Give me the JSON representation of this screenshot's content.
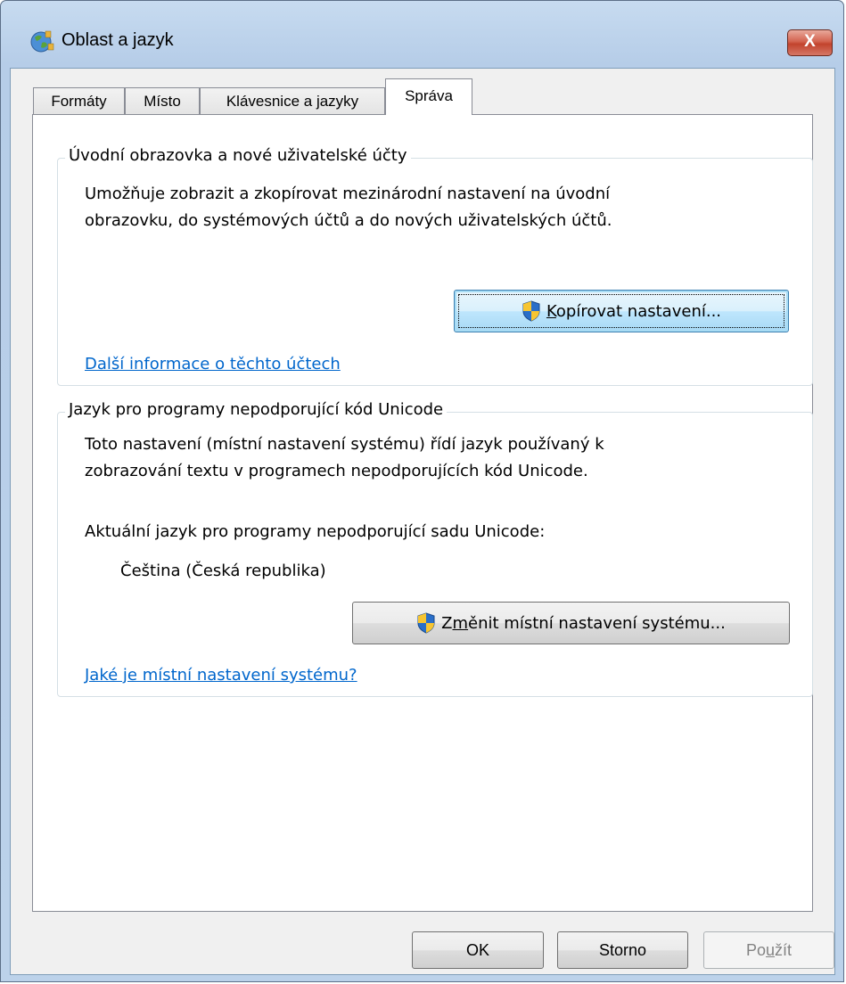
{
  "window": {
    "title": "Oblast a jazyk",
    "close_glyph": "X",
    "icon": "globe-icon"
  },
  "tabs": [
    {
      "label": "Formáty",
      "active": false
    },
    {
      "label": "Místo",
      "active": false
    },
    {
      "label": "Klávesnice a jazyky",
      "active": false
    },
    {
      "label": "Správa",
      "active": true
    }
  ],
  "welcome_group": {
    "title": "Úvodní obrazovka a nové uživatelské účty",
    "description_line1": "Umožňuje zobrazit a zkopírovat mezinárodní nastavení na úvodní",
    "description_line2": "obrazovku, do systémových účtů a do nových uživatelských účtů.",
    "copy_button_accel": "K",
    "copy_button_rest": "opírovat nastavení...",
    "more_info_link": "Další informace o těchto účtech"
  },
  "unicode_group": {
    "title": "Jazyk pro programy nepodporující kód Unicode",
    "description_line1": "Toto nastavení (místní nastavení systému) řídí jazyk používaný k",
    "description_line2": "zobrazování textu v programech nepodporujících kód Unicode.",
    "current_label": "Aktuální jazyk pro programy nepodporující sadu Unicode:",
    "current_value": "Čeština (Česká republika)",
    "change_button_pre": "Z",
    "change_button_accel": "m",
    "change_button_rest": "ěnit místní nastavení systému...",
    "what_is_link": "Jaké je místní nastavení systému?"
  },
  "footer": {
    "ok_label": "OK",
    "cancel_label": "Storno",
    "apply_pre": "Po",
    "apply_accel": "u",
    "apply_rest": "žít",
    "apply_enabled": false
  },
  "colors": {
    "link": "#0066cc",
    "close_button": "#c2432d",
    "uac_shield_blue": "#2a6fc9",
    "uac_shield_yellow": "#f7c531"
  }
}
